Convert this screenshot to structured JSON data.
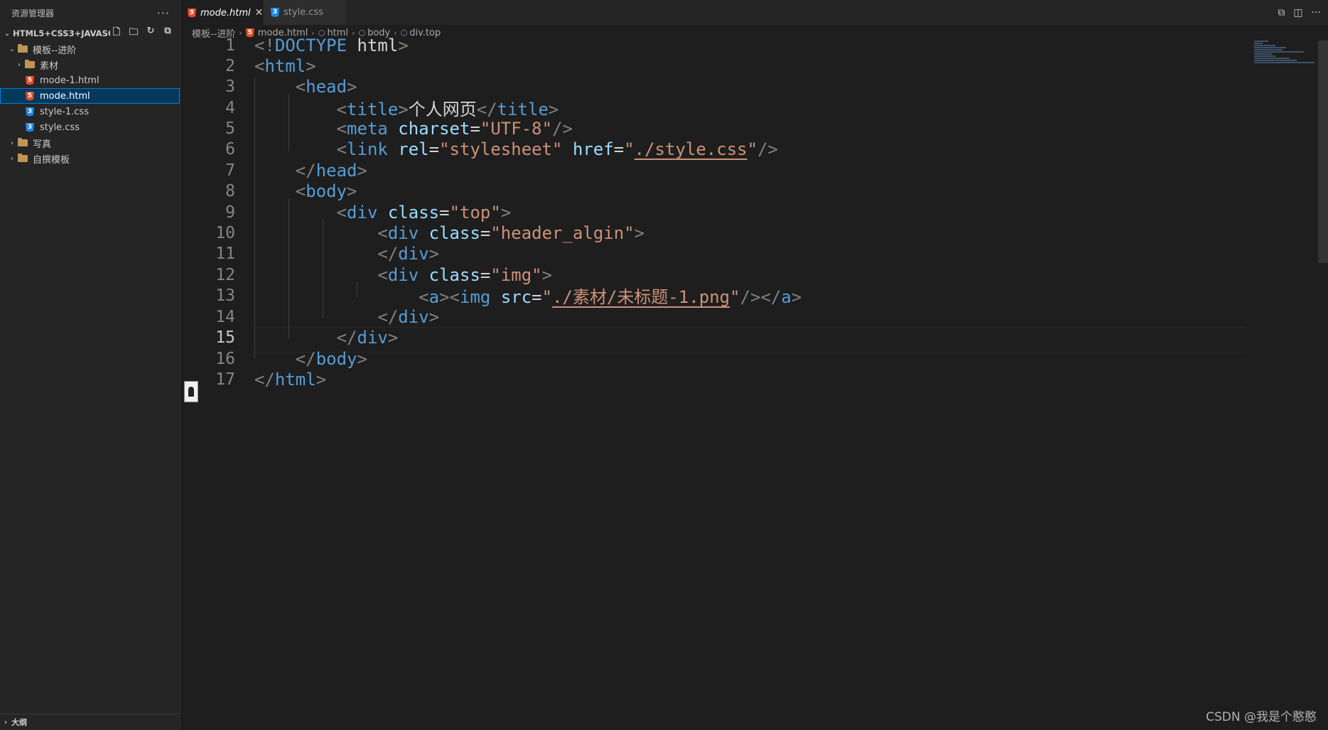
{
  "sidebar": {
    "title": "资源管理器",
    "more_label": "···",
    "workspace": "HTML5+CSS3+JAVASCRI...",
    "tree": [
      {
        "label": "模板--进阶",
        "kind": "folder",
        "open": true,
        "depth": 1
      },
      {
        "label": "素材",
        "kind": "folder",
        "open": false,
        "depth": 2
      },
      {
        "label": "mode-1.html",
        "kind": "html",
        "depth": 2
      },
      {
        "label": "mode.html",
        "kind": "html",
        "depth": 2,
        "selected": true
      },
      {
        "label": "style-1.css",
        "kind": "css",
        "depth": 2
      },
      {
        "label": "style.css",
        "kind": "css",
        "depth": 2
      },
      {
        "label": "写真",
        "kind": "folder",
        "open": false,
        "depth": 1
      },
      {
        "label": "自撰模板",
        "kind": "folder",
        "open": false,
        "depth": 1
      }
    ],
    "outline_label": "大纲"
  },
  "tabs": [
    {
      "label": "mode.html",
      "kind": "html",
      "active": true,
      "close": "✕"
    },
    {
      "label": "style.css",
      "kind": "css",
      "active": false
    }
  ],
  "breadcrumb": [
    "模板--进阶",
    "mode.html",
    "html",
    "body",
    "div.top"
  ],
  "editor": {
    "current_line": 15,
    "lines": [
      "1",
      "2",
      "3",
      "4",
      "5",
      "6",
      "7",
      "8",
      "9",
      "10",
      "11",
      "12",
      "13",
      "14",
      "15",
      "16",
      "17"
    ],
    "code": {
      "l1_a": "<!",
      "l1_b": "DOCTYPE",
      "l1_c": " html",
      "l1_d": ">",
      "l2_tag": "html",
      "l3_tag": "head",
      "l4_tag": "title",
      "l4_text": "个人网页",
      "l5_tag": "meta",
      "l5_attr": "charset",
      "l5_val": "\"UTF-8\"",
      "l6_tag": "link",
      "l6_attr1": "rel",
      "l6_val1": "\"stylesheet\"",
      "l6_attr2": "href",
      "l6_val2": "./style.css",
      "l7_tag": "head",
      "l8_tag": "body",
      "l9_tag": "div",
      "l9_attr": "class",
      "l9_val": "\"top\"",
      "l10_tag": "div",
      "l10_attr": "class",
      "l10_val": "\"header_algin\"",
      "l11_tag": "div",
      "l12_tag": "div",
      "l12_attr": "class",
      "l12_val": "\"img\"",
      "l13_tag1": "a",
      "l13_tag2": "img",
      "l13_attr": "src",
      "l13_val": "./素材/未标题-1.png",
      "l13_tag3": "a",
      "l14_tag": "div",
      "l15_tag": "div",
      "l16_tag": "body",
      "l17_tag": "html"
    }
  },
  "watermark": "CSDN @我是个憨憨",
  "colors": {
    "tag": "#569cd6",
    "attr": "#9cdcfe",
    "string": "#ce9178",
    "punctuation": "#808080",
    "selection": "#04395e"
  }
}
